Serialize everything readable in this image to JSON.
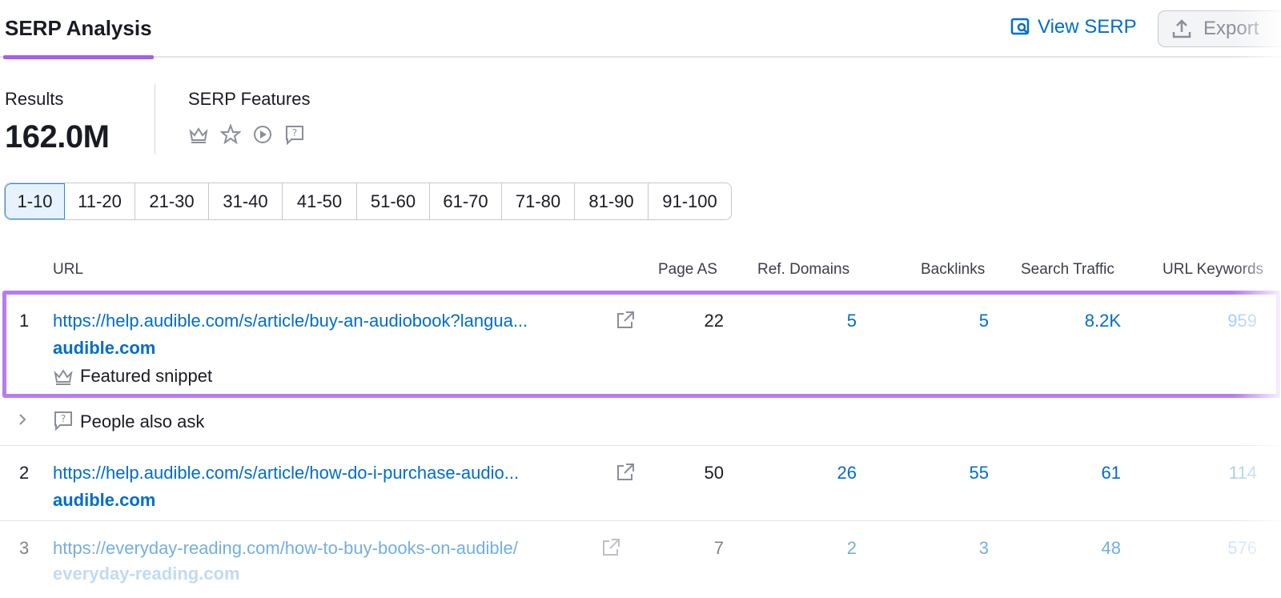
{
  "header": {
    "title": "SERP Analysis",
    "view_serp_label": "View SERP",
    "export_label": "Export"
  },
  "stats": {
    "results_label": "Results",
    "results_value": "162.0M",
    "features_label": "SERP Features",
    "feature_icons": [
      "crown-icon",
      "star-icon",
      "play-circle-icon",
      "question-box-icon"
    ]
  },
  "pagination": [
    "1-10",
    "11-20",
    "21-30",
    "31-40",
    "41-50",
    "51-60",
    "61-70",
    "71-80",
    "81-90",
    "91-100"
  ],
  "table": {
    "headers": {
      "url": "URL",
      "page_as": "Page AS",
      "ref_domains": "Ref. Domains",
      "backlinks": "Backlinks",
      "search_traffic": "Search Traffic",
      "url_keywords": "URL Keywords"
    },
    "rows": [
      {
        "num": "1",
        "url": "https://help.audible.com/s/article/buy-an-audiobook?langua...",
        "domain": "audible.com",
        "page_as": "22",
        "ref_domains": "5",
        "backlinks": "5",
        "search_traffic": "8.2K",
        "url_keywords": "959",
        "feature": "Featured snippet"
      },
      {
        "num": "2",
        "url": "https://help.audible.com/s/article/how-do-i-purchase-audio...",
        "domain": "audible.com",
        "page_as": "50",
        "ref_domains": "26",
        "backlinks": "55",
        "search_traffic": "61",
        "url_keywords": "114"
      },
      {
        "num": "3",
        "url": "https://everyday-reading.com/how-to-buy-books-on-audible/",
        "domain": "everyday-reading.com",
        "page_as": "7",
        "ref_domains": "2",
        "backlinks": "3",
        "search_traffic": "48",
        "url_keywords": "576"
      }
    ],
    "people_also_ask": "People also ask"
  },
  "colors": {
    "accent": "#a75ef0",
    "highlight": "#b77cf4",
    "link": "#006dca"
  }
}
